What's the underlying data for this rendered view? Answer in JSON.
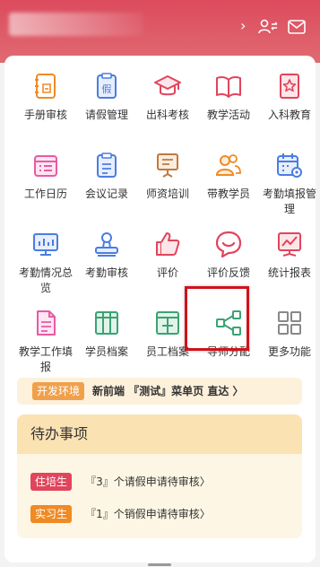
{
  "header": {
    "chevron": "›",
    "icons": [
      "switch-user-icon",
      "mail-icon"
    ],
    "colors": {
      "background": "#dc4b5d"
    }
  },
  "menu": {
    "rows": [
      [
        {
          "label": "手册审核",
          "icon": "handbook-icon",
          "color": "#f08a24"
        },
        {
          "label": "请假管理",
          "icon": "leave-icon",
          "color": "#4a7de2"
        },
        {
          "label": "出科考核",
          "icon": "graduation-cap-icon",
          "color": "#e0455c"
        },
        {
          "label": "教学活动",
          "icon": "book-icon",
          "color": "#e0455c"
        },
        {
          "label": "入科教育",
          "icon": "star-book-icon",
          "color": "#e0455c"
        }
      ],
      [
        {
          "label": "工作日历",
          "icon": "calendar-list-icon",
          "color": "#e85aa6"
        },
        {
          "label": "会议记录",
          "icon": "clipboard-icon",
          "color": "#4a7de2"
        },
        {
          "label": "师资培训",
          "icon": "training-board-icon",
          "color": "#c07a3e"
        },
        {
          "label": "带教学员",
          "icon": "students-icon",
          "color": "#f08a24"
        },
        {
          "label": "考勤填报管理",
          "icon": "calendar-settings-icon",
          "color": "#4a7de2"
        }
      ],
      [
        {
          "label": "考勤情况总览",
          "icon": "chart-screen-icon",
          "color": "#4a7de2"
        },
        {
          "label": "考勤审核",
          "icon": "stamp-icon",
          "color": "#4a7de2"
        },
        {
          "label": "评价",
          "icon": "thumbs-up-icon",
          "color": "#e0455c"
        },
        {
          "label": "评价反馈",
          "icon": "smile-chat-icon",
          "color": "#e0455c"
        },
        {
          "label": "统计报表",
          "icon": "line-chart-icon",
          "color": "#e0455c"
        }
      ],
      [
        {
          "label": "教学工作填报",
          "icon": "document-icon",
          "color": "#e85aa6"
        },
        {
          "label": "学员档案",
          "icon": "archive-grid-icon",
          "color": "#3aa373"
        },
        {
          "label": "员工档案",
          "icon": "archive-plus-icon",
          "color": "#3aa373"
        },
        {
          "label": "导师分配",
          "icon": "share-nodes-icon",
          "color": "#3aa373"
        },
        {
          "label": "更多功能",
          "icon": "grid-icon",
          "color": "#888888"
        }
      ]
    ]
  },
  "dev_bar": {
    "tag": "开发环境",
    "text": "新前端 『测试』菜单页 直达 〉",
    "colors": {
      "tag": "#f0a04b",
      "background": "#fdf1dc"
    }
  },
  "todo": {
    "title": "待办事项",
    "items": [
      {
        "tag": "住培生",
        "tag_color": "#e0455c",
        "text": "『3』个请假申请待审核〉"
      },
      {
        "tag": "实习生",
        "tag_color": "#f08a24",
        "text": "『1』个销假申请待审核〉"
      }
    ]
  }
}
